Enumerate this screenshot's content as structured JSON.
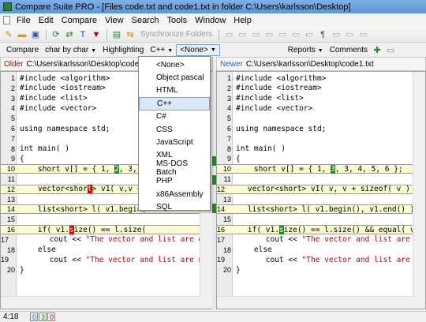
{
  "window": {
    "title": "Compare Suite PRO - [Files code.txt and code1.txt in folder C:\\Users\\karlsson\\Desktop]"
  },
  "menu": [
    "File",
    "Edit",
    "Compare",
    "View",
    "Search",
    "Tools",
    "Window",
    "Help"
  ],
  "toolbar": {
    "sync_label": "Synchronize Folders",
    "reports_label": "Reports",
    "comments_label": "Comments"
  },
  "toolbar2": {
    "compare_label": "Compare",
    "mode_label": "char by char",
    "highlighting_label": "Highlighting",
    "lang_label": "C++",
    "none_label": "<None>"
  },
  "left_pane": {
    "label": "Older",
    "path": "C:\\Users\\karlsson\\Desktop\\code.txt"
  },
  "right_pane": {
    "label": "Newer",
    "path": "C:\\Users\\karlsson\\Desktop\\code1.txt"
  },
  "left_lines": [
    {
      "n": "1",
      "t": "#include <algorithm>"
    },
    {
      "n": "2",
      "t": "#include <iostream>"
    },
    {
      "n": "3",
      "t": "#include <list>"
    },
    {
      "n": "4",
      "t": "#include <vector>"
    },
    {
      "n": "5",
      "t": ""
    },
    {
      "n": "6",
      "t": "using namespace std;"
    },
    {
      "n": "7",
      "t": ""
    },
    {
      "n": "8",
      "t": "int main( )"
    },
    {
      "n": "9",
      "t": "{"
    },
    {
      "n": "10",
      "t": "    short v[] = { 1, 2, 3, 4"
    },
    {
      "n": "11",
      "t": ""
    },
    {
      "n": "12",
      "t": "    vector<short> v1( v,v + s"
    },
    {
      "n": "13",
      "t": ""
    },
    {
      "n": "14",
      "t": "    list<short> l( v1.begin("
    },
    {
      "n": "15",
      "t": ""
    },
    {
      "n": "16",
      "t": "    if( v1.size() == l.size("
    },
    {
      "n": "17",
      "t": "        cout << \"The vector and list are equal"
    },
    {
      "n": "18",
      "t": "    else"
    },
    {
      "n": "19",
      "t": "        cout << \"The vector and list are not e"
    },
    {
      "n": "20",
      "t": "}"
    }
  ],
  "right_lines": [
    {
      "n": "1",
      "t": "#include <algorithm>"
    },
    {
      "n": "2",
      "t": "#include <iostream>"
    },
    {
      "n": "3",
      "t": "#include <list>"
    },
    {
      "n": "4",
      "t": "#include <vector>"
    },
    {
      "n": "5",
      "t": ""
    },
    {
      "n": "6",
      "t": "using namespace std;"
    },
    {
      "n": "7",
      "t": ""
    },
    {
      "n": "8",
      "t": "int main( )"
    },
    {
      "n": "9",
      "t": "{"
    },
    {
      "n": "10",
      "t": "    short v[] = { 1, 3, 3, 4, 5, 6 };"
    },
    {
      "n": "11",
      "t": ""
    },
    {
      "n": "12",
      "t": "    vector<short> v1( v, v + sizeof( v ) / siz"
    },
    {
      "n": "13",
      "t": ""
    },
    {
      "n": "14",
      "t": "    list<short> l( v1.begin(), v1.end() );"
    },
    {
      "n": "15",
      "t": ""
    },
    {
      "n": "16",
      "t": "    if( v1.size() == l.size() && equal( v1.b"
    },
    {
      "n": "17",
      "t": "        cout << \"The vector and list are equal"
    },
    {
      "n": "18",
      "t": "    else"
    },
    {
      "n": "19",
      "t": "        cout << \"The vector and list are not e"
    },
    {
      "n": "20",
      "t": "}"
    }
  ],
  "dropdown": [
    "<None>",
    "Object pascal",
    "HTML",
    "C++",
    "C#",
    "CSS",
    "JavaScript",
    "XML",
    "MS-DOS Batch",
    "PHP",
    "x86Assembly",
    "SQL"
  ],
  "dropdown_selected": "C++",
  "status": {
    "position": "4:18",
    "c1": "0",
    "c2": "3",
    "c3": "0"
  }
}
